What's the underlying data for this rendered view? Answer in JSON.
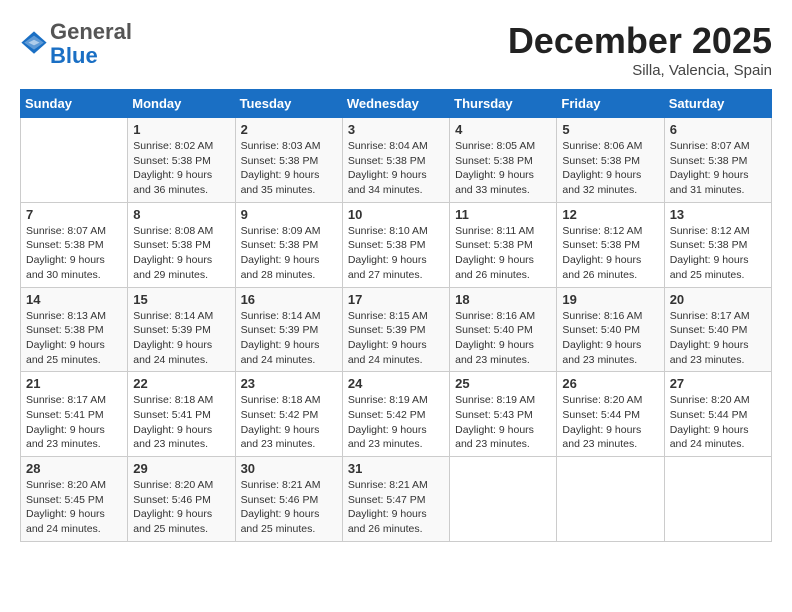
{
  "header": {
    "logo_line1": "General",
    "logo_line2": "Blue",
    "month": "December 2025",
    "location": "Silla, Valencia, Spain"
  },
  "days_of_week": [
    "Sunday",
    "Monday",
    "Tuesday",
    "Wednesday",
    "Thursday",
    "Friday",
    "Saturday"
  ],
  "weeks": [
    [
      {
        "day": null,
        "info": null
      },
      {
        "day": "1",
        "info": "Sunrise: 8:02 AM\nSunset: 5:38 PM\nDaylight: 9 hours\nand 36 minutes."
      },
      {
        "day": "2",
        "info": "Sunrise: 8:03 AM\nSunset: 5:38 PM\nDaylight: 9 hours\nand 35 minutes."
      },
      {
        "day": "3",
        "info": "Sunrise: 8:04 AM\nSunset: 5:38 PM\nDaylight: 9 hours\nand 34 minutes."
      },
      {
        "day": "4",
        "info": "Sunrise: 8:05 AM\nSunset: 5:38 PM\nDaylight: 9 hours\nand 33 minutes."
      },
      {
        "day": "5",
        "info": "Sunrise: 8:06 AM\nSunset: 5:38 PM\nDaylight: 9 hours\nand 32 minutes."
      },
      {
        "day": "6",
        "info": "Sunrise: 8:07 AM\nSunset: 5:38 PM\nDaylight: 9 hours\nand 31 minutes."
      }
    ],
    [
      {
        "day": "7",
        "info": "Sunrise: 8:07 AM\nSunset: 5:38 PM\nDaylight: 9 hours\nand 30 minutes."
      },
      {
        "day": "8",
        "info": "Sunrise: 8:08 AM\nSunset: 5:38 PM\nDaylight: 9 hours\nand 29 minutes."
      },
      {
        "day": "9",
        "info": "Sunrise: 8:09 AM\nSunset: 5:38 PM\nDaylight: 9 hours\nand 28 minutes."
      },
      {
        "day": "10",
        "info": "Sunrise: 8:10 AM\nSunset: 5:38 PM\nDaylight: 9 hours\nand 27 minutes."
      },
      {
        "day": "11",
        "info": "Sunrise: 8:11 AM\nSunset: 5:38 PM\nDaylight: 9 hours\nand 26 minutes."
      },
      {
        "day": "12",
        "info": "Sunrise: 8:12 AM\nSunset: 5:38 PM\nDaylight: 9 hours\nand 26 minutes."
      },
      {
        "day": "13",
        "info": "Sunrise: 8:12 AM\nSunset: 5:38 PM\nDaylight: 9 hours\nand 25 minutes."
      }
    ],
    [
      {
        "day": "14",
        "info": "Sunrise: 8:13 AM\nSunset: 5:38 PM\nDaylight: 9 hours\nand 25 minutes."
      },
      {
        "day": "15",
        "info": "Sunrise: 8:14 AM\nSunset: 5:39 PM\nDaylight: 9 hours\nand 24 minutes."
      },
      {
        "day": "16",
        "info": "Sunrise: 8:14 AM\nSunset: 5:39 PM\nDaylight: 9 hours\nand 24 minutes."
      },
      {
        "day": "17",
        "info": "Sunrise: 8:15 AM\nSunset: 5:39 PM\nDaylight: 9 hours\nand 24 minutes."
      },
      {
        "day": "18",
        "info": "Sunrise: 8:16 AM\nSunset: 5:40 PM\nDaylight: 9 hours\nand 23 minutes."
      },
      {
        "day": "19",
        "info": "Sunrise: 8:16 AM\nSunset: 5:40 PM\nDaylight: 9 hours\nand 23 minutes."
      },
      {
        "day": "20",
        "info": "Sunrise: 8:17 AM\nSunset: 5:40 PM\nDaylight: 9 hours\nand 23 minutes."
      }
    ],
    [
      {
        "day": "21",
        "info": "Sunrise: 8:17 AM\nSunset: 5:41 PM\nDaylight: 9 hours\nand 23 minutes."
      },
      {
        "day": "22",
        "info": "Sunrise: 8:18 AM\nSunset: 5:41 PM\nDaylight: 9 hours\nand 23 minutes."
      },
      {
        "day": "23",
        "info": "Sunrise: 8:18 AM\nSunset: 5:42 PM\nDaylight: 9 hours\nand 23 minutes."
      },
      {
        "day": "24",
        "info": "Sunrise: 8:19 AM\nSunset: 5:42 PM\nDaylight: 9 hours\nand 23 minutes."
      },
      {
        "day": "25",
        "info": "Sunrise: 8:19 AM\nSunset: 5:43 PM\nDaylight: 9 hours\nand 23 minutes."
      },
      {
        "day": "26",
        "info": "Sunrise: 8:20 AM\nSunset: 5:44 PM\nDaylight: 9 hours\nand 23 minutes."
      },
      {
        "day": "27",
        "info": "Sunrise: 8:20 AM\nSunset: 5:44 PM\nDaylight: 9 hours\nand 24 minutes."
      }
    ],
    [
      {
        "day": "28",
        "info": "Sunrise: 8:20 AM\nSunset: 5:45 PM\nDaylight: 9 hours\nand 24 minutes."
      },
      {
        "day": "29",
        "info": "Sunrise: 8:20 AM\nSunset: 5:46 PM\nDaylight: 9 hours\nand 25 minutes."
      },
      {
        "day": "30",
        "info": "Sunrise: 8:21 AM\nSunset: 5:46 PM\nDaylight: 9 hours\nand 25 minutes."
      },
      {
        "day": "31",
        "info": "Sunrise: 8:21 AM\nSunset: 5:47 PM\nDaylight: 9 hours\nand 26 minutes."
      },
      {
        "day": null,
        "info": null
      },
      {
        "day": null,
        "info": null
      },
      {
        "day": null,
        "info": null
      }
    ]
  ]
}
